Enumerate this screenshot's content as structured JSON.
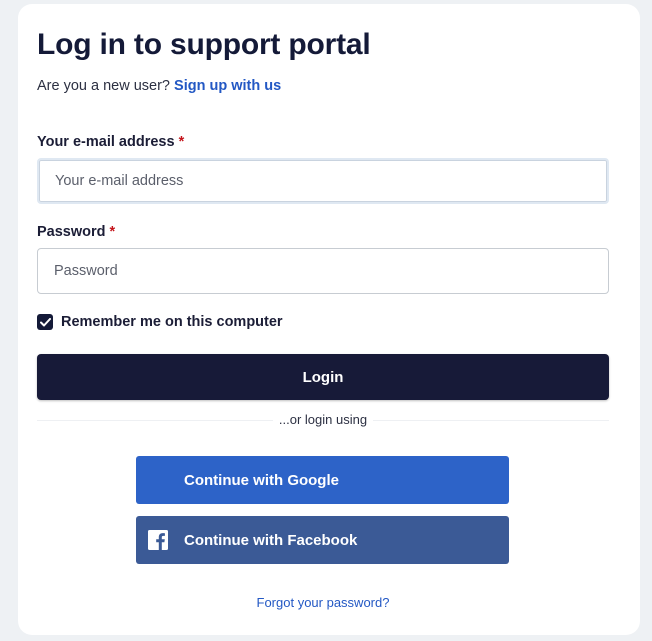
{
  "page": {
    "title": "Log in to support portal",
    "new_user_prompt": "Are you a new user?",
    "signup_link": "Sign up with us"
  },
  "form": {
    "email_label": "Your e-mail address",
    "email_placeholder": "Your e-mail address",
    "email_value": "",
    "password_label": "Password",
    "password_placeholder": "Password",
    "password_value": "",
    "required_marker": "*",
    "remember_label": "Remember me on this computer",
    "remember_checked": true,
    "login_label": "Login"
  },
  "social": {
    "separator_text": "...or login using",
    "google_label": "Continue with Google",
    "facebook_label": "Continue with Facebook"
  },
  "footer": {
    "forgot_password": "Forgot your password?"
  },
  "colors": {
    "primary_dark": "#171a38",
    "link_blue": "#2358c4",
    "google_blue": "#2d63c8",
    "facebook_blue": "#3b5a96",
    "required_red": "#c4141b"
  },
  "icons": {
    "checkbox": "check-icon",
    "facebook": "facebook-icon"
  }
}
